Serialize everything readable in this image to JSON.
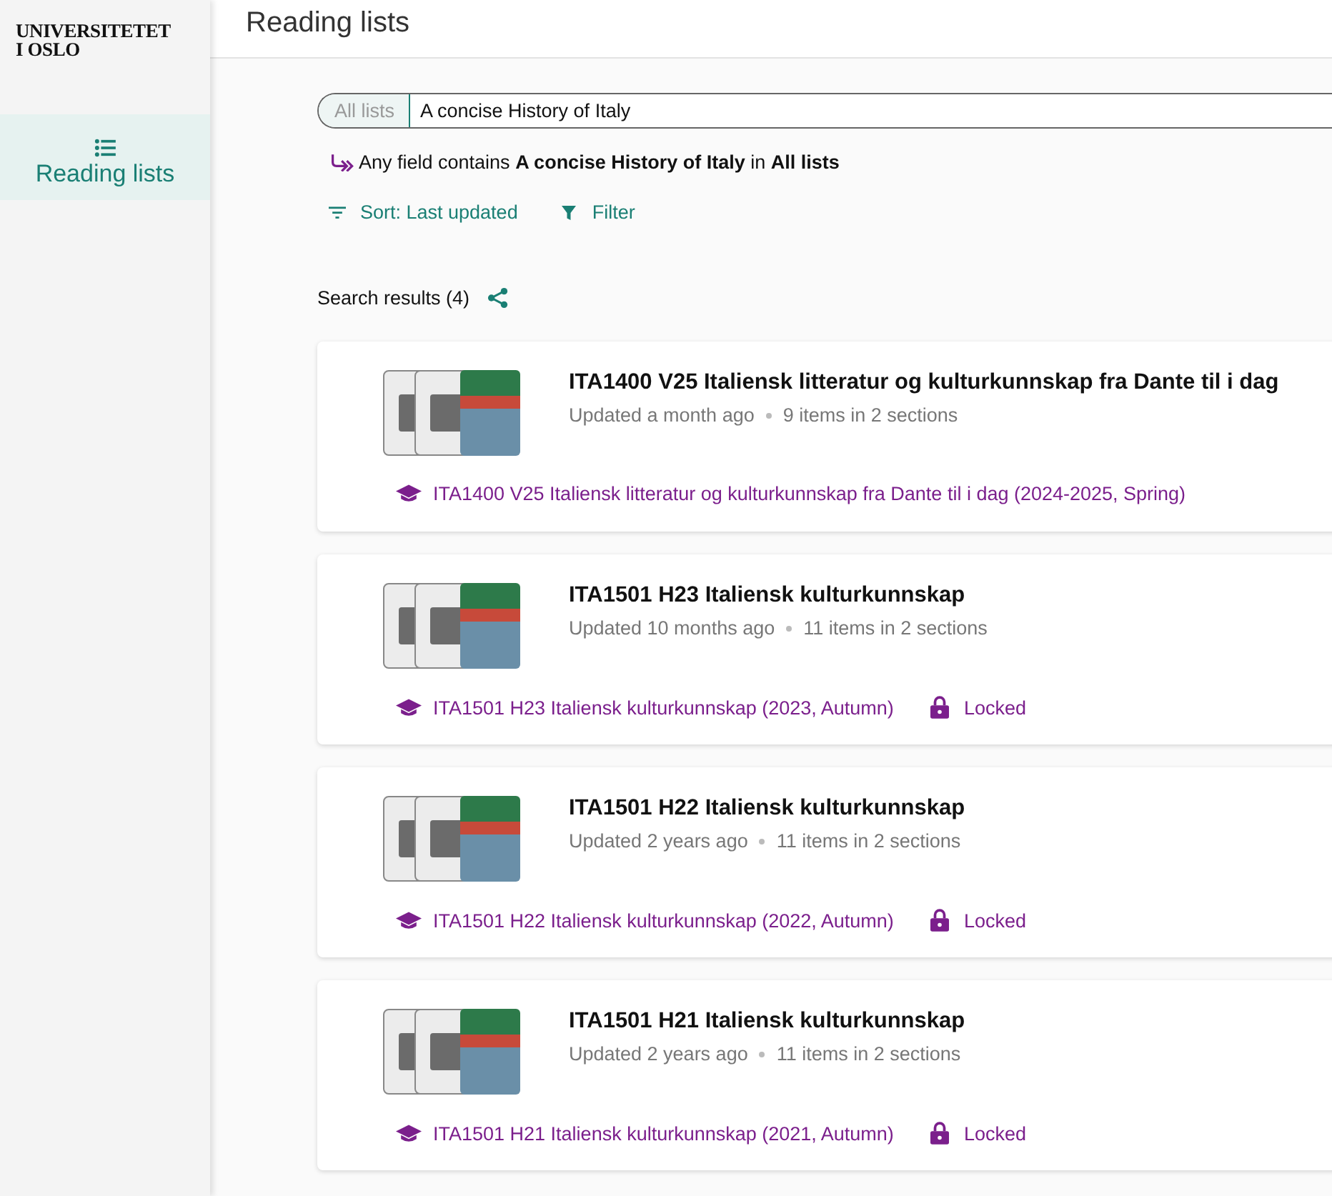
{
  "sidebar": {
    "logo": [
      "UNIVERSITETET",
      "I OSLO"
    ],
    "items": [
      {
        "label": "Reading lists",
        "selected": true
      }
    ]
  },
  "header": {
    "title": "Reading lists"
  },
  "search": {
    "scope": "All lists",
    "value": "A concise History of Italy"
  },
  "query_summary": "Any field contains **A concise History of Italy** in **All lists**",
  "toolbar": {
    "sort": "Sort: Last updated",
    "filter": "Filter"
  },
  "results_heading": "Search results (4)",
  "results": [
    {
      "title": "ITA1400 V25 Italiensk litteratur og kulturkunnskap fra Dante til i dag",
      "updated": "Updated a month ago",
      "items": "9 items in 2 sections",
      "course": "ITA1400 V25 Italiensk litteratur og kulturkunnskap fra Dante til i dag (2024-2025, Spring)",
      "locked": false
    },
    {
      "title": "ITA1501 H23 Italiensk kulturkunnskap",
      "updated": "Updated 10 months ago",
      "items": "11 items in 2 sections",
      "course": "ITA1501 H23 Italiensk kulturkunnskap (2023, Autumn)",
      "locked": true,
      "locked_label": "Locked"
    },
    {
      "title": "ITA1501 H22 Italiensk kulturkunnskap",
      "updated": "Updated 2 years ago",
      "items": "11 items in 2 sections",
      "course": "ITA1501 H22 Italiensk kulturkunnskap (2022, Autumn)",
      "locked": true,
      "locked_label": "Locked"
    },
    {
      "title": "ITA1501 H21 Italiensk kulturkunnskap",
      "updated": "Updated 2 years ago",
      "items": "11 items in 2 sections",
      "course": "ITA1501 H21 Italiensk kulturkunnskap (2021, Autumn)",
      "locked": true,
      "locked_label": "Locked"
    }
  ]
}
